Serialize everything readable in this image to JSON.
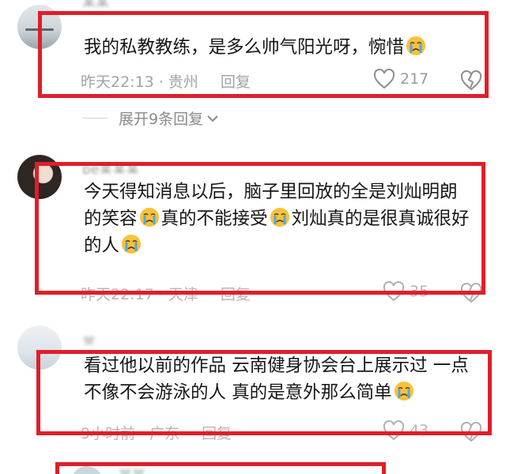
{
  "comments": [
    {
      "username": "某某",
      "text_parts": [
        "我的私教教练，是多么帅气阳光呀，惋惜"
      ],
      "time": "昨天22:13",
      "location": "贵州",
      "reply_label": "回复",
      "likes": "217"
    },
    {
      "username": "pe某某某",
      "text_parts": [
        "今天得知消息以后，脑子里回放的全是刘灿明朗的笑容",
        "真的不能接受",
        "刘灿真的是很真诚很好的人"
      ],
      "time": "昨天22:17",
      "location": "天津",
      "reply_label": "回复",
      "likes": "35"
    },
    {
      "username": "某",
      "text_parts": [
        "看过他以前的作品 云南健身协会台上展示过 一点不像不会游泳的人 真的是意外那么简单"
      ],
      "time": "9小时前",
      "location": "广东",
      "reply_label": "回复",
      "likes": "43"
    },
    {
      "username": "某某"
    }
  ],
  "expand_replies": "展开9条回复",
  "separator": "·",
  "icons": {
    "like": "heart-icon",
    "dislike": "broken-heart-icon",
    "emoji": "crying-face-emoji",
    "expand": "chevron-down-icon"
  },
  "colors": {
    "highlight_border": "#e01e2a",
    "meta_text": "#a3a3a3",
    "comment_text": "#161616"
  }
}
